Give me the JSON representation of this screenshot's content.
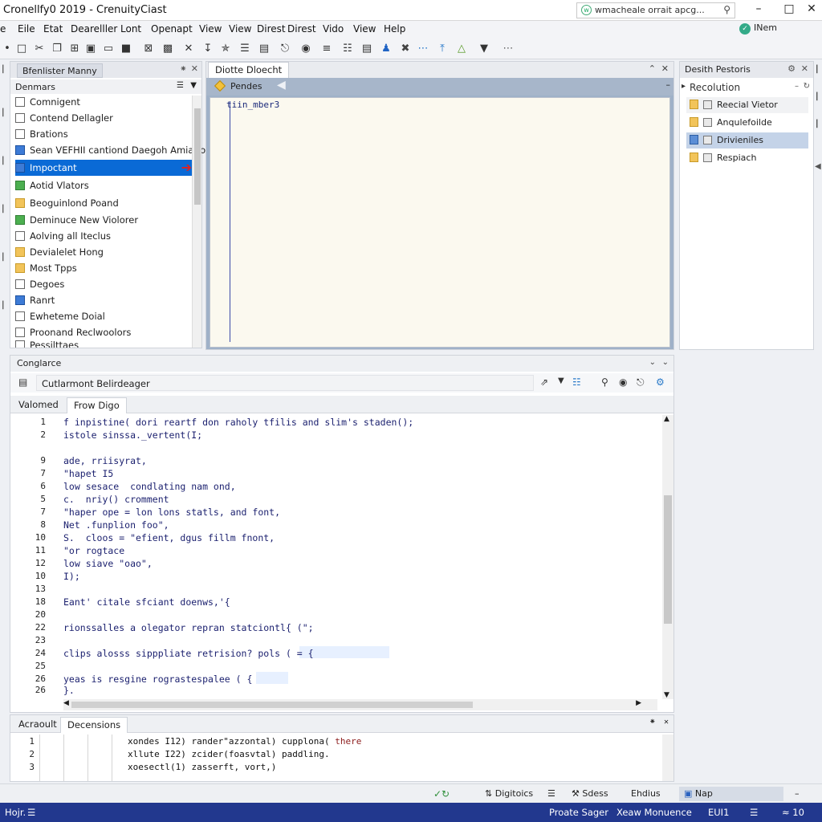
{
  "window": {
    "title": "Cronellfy0 2019 - CrenuityCiast",
    "search_text": "wmacheale orrait apcg..."
  },
  "menubar": {
    "items": [
      "Eile",
      "Etat",
      "Dearelller",
      "Lont",
      "Openapt",
      "View",
      "View",
      "Direst",
      "Vido",
      "View",
      "Help"
    ],
    "user": "INem"
  },
  "left_panel": {
    "tab": "Bfenlister Manny",
    "section": "Denmars",
    "items": [
      {
        "label": "Comnigent"
      },
      {
        "label": "Contend Dellagler"
      },
      {
        "label": "Brations"
      },
      {
        "label": "Sean VEFHII cantiond Daegoh Amiation"
      },
      {
        "label": "Impoctant",
        "selected": true
      },
      {
        "label": "Aotid Vlators"
      },
      {
        "label": "Beoguinlond Poand"
      },
      {
        "label": "Deminuce New Violorer"
      },
      {
        "label": "Aolving all Iteclus"
      },
      {
        "label": "Devialelet Hong"
      },
      {
        "label": "Most Tpps"
      },
      {
        "label": "Degoes"
      },
      {
        "label": "Ranrt"
      },
      {
        "label": "Ewheteme Doial"
      },
      {
        "label": "Proonand Reclwoolors"
      },
      {
        "label": "Pessilttaes"
      }
    ]
  },
  "editor": {
    "tab": "Diotte Dloecht",
    "breadcrumb": "Pendes",
    "first_line": "tiin_mber3"
  },
  "right_panel": {
    "title": "Desith Pestoris",
    "section": "Recolution",
    "items": [
      {
        "label": "Reecial Vietor"
      },
      {
        "label": "Anqulefoilde"
      },
      {
        "label": "Drivieniles",
        "selected": true
      },
      {
        "label": "Respiach"
      }
    ]
  },
  "console": {
    "title": "Conglarce",
    "field_text": "Cutlarmont Belirdeager",
    "tabs": [
      "Valomed",
      "Frow Digo"
    ],
    "lines": [
      {
        "n": "1",
        "text": "f inpistine( dori reartf don raholy tfilis and slim's staden();"
      },
      {
        "n": "2",
        "text": "istole sinssa._vertent(I;"
      },
      {
        "n": "9",
        "text": "ade, rriisyrat,"
      },
      {
        "n": "7",
        "text": "\"hapet I5"
      },
      {
        "n": "6",
        "text": "low sesace  condlating nam ond,"
      },
      {
        "n": "5",
        "text": "c.  nriy() cromment"
      },
      {
        "n": "7",
        "text": "\"haper ope = lon lons statls, and font,"
      },
      {
        "n": "8",
        "text": "Net .funplion foo\","
      },
      {
        "n": "10",
        "text": "S.  cloos = \"efient, dgus fillm fnont,"
      },
      {
        "n": "11",
        "text": "\"or rogtace"
      },
      {
        "n": "12",
        "text": "low siave \"oao\","
      },
      {
        "n": "10",
        "text": "I);"
      },
      {
        "n": "13",
        "text": ""
      },
      {
        "n": "18",
        "text": "Eant' citale sfciant doenws,'{"
      },
      {
        "n": "20",
        "text": ""
      },
      {
        "n": "22",
        "text": "rionssalles a olegator repran statciontl{ (\";"
      },
      {
        "n": "23",
        "text": ""
      },
      {
        "n": "24",
        "text": "clips alosss sipppliate retrision? pols ( = {"
      },
      {
        "n": "25",
        "text": ""
      },
      {
        "n": "26",
        "text": "yeas is resgine rograstespalee ( {"
      },
      {
        "n": "26",
        "text": "}."
      }
    ]
  },
  "output": {
    "tabs": [
      "Acraoult",
      "Decensions"
    ],
    "lines": [
      {
        "n": "1",
        "text": "xondes I12) rander\"azzontal) cupplona( ",
        "accent": "there"
      },
      {
        "n": "2",
        "text": "xllute I22) zcider(foasvtal) paddling.",
        "accent": ""
      },
      {
        "n": "3",
        "text": "xoesectl(1) zasserft, vort,)",
        "accent": ""
      }
    ]
  },
  "bottomline": {
    "digitios": "Digitoics",
    "sdess": "Sdess",
    "ehdius": "Ehdius",
    "nap": "Nap"
  },
  "statusbar": {
    "left": "Hojr.",
    "center": "Proate Sager",
    "right": "Xeaw Monuence",
    "pos": "EUI1",
    "num": "≈ 10"
  },
  "colors": {
    "statusbar": "#22388e",
    "selection": "#0a6ad6",
    "editor_bg": "#fbf9ef"
  }
}
